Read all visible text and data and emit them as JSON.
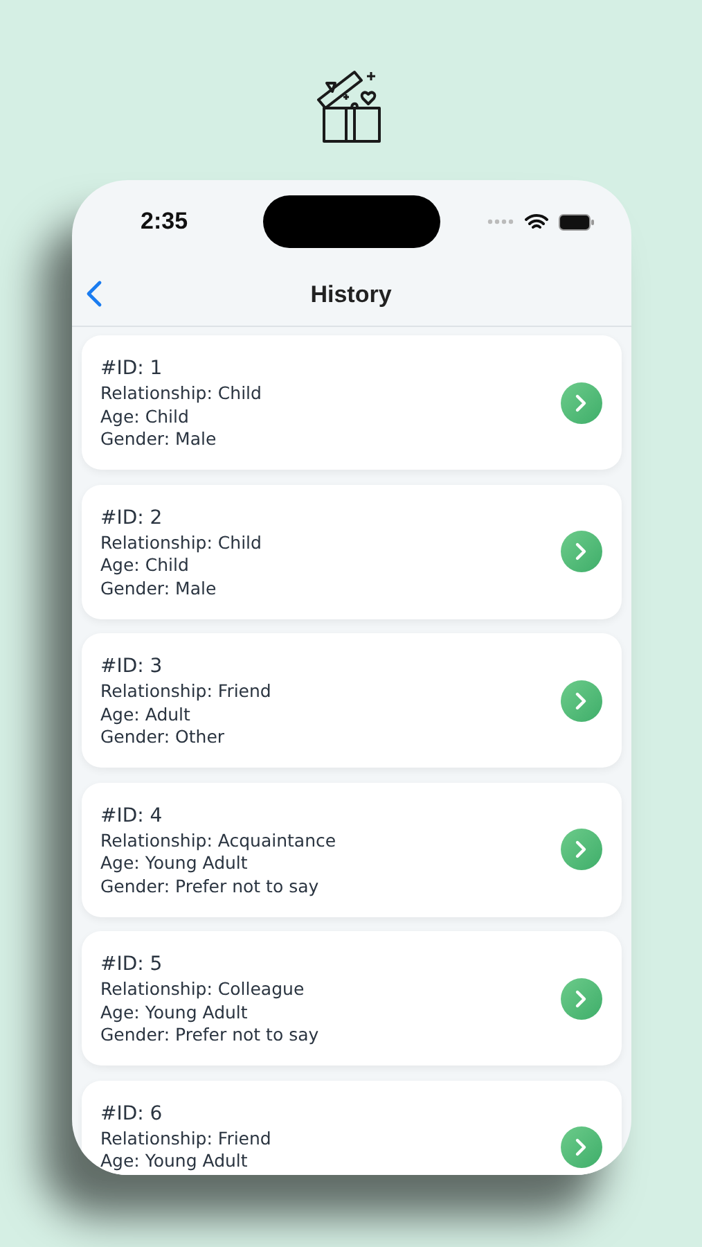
{
  "status_bar": {
    "time": "2:35"
  },
  "nav": {
    "title": "History"
  },
  "records": [
    {
      "id": "#ID: 1",
      "lines": [
        "Relationship: Child",
        "Age: Child",
        "Gender: Male"
      ]
    },
    {
      "id": "#ID: 2",
      "lines": [
        "Relationship: Child",
        "Age: Child",
        "Gender: Male"
      ]
    },
    {
      "id": "#ID: 3",
      "lines": [
        "Relationship: Friend",
        "Age: Adult",
        "Gender: Other"
      ]
    },
    {
      "id": "#ID: 4",
      "lines": [
        "Relationship: Acquaintance",
        "Age: Young Adult",
        "Gender: Prefer not to say"
      ]
    },
    {
      "id": "#ID: 5",
      "lines": [
        "Relationship: Colleague",
        "Age: Young Adult",
        "Gender: Prefer not to say"
      ]
    },
    {
      "id": "#ID: 6",
      "lines": [
        "Relationship: Friend",
        "Age: Young Adult"
      ]
    }
  ]
}
